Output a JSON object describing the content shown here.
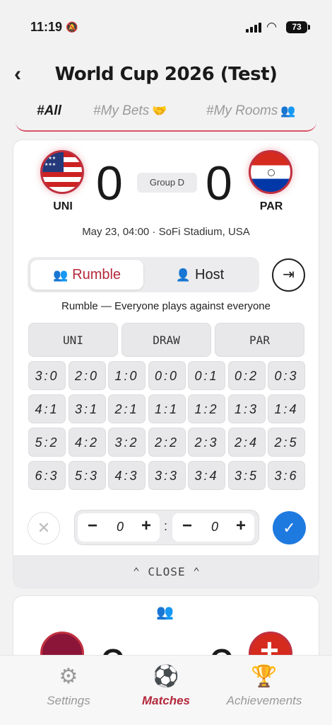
{
  "status": {
    "time": "11:19",
    "battery": "73"
  },
  "header": {
    "title": "World Cup 2026 (Test)"
  },
  "tabs": [
    {
      "label": "#All"
    },
    {
      "label": "#My Bets"
    },
    {
      "label": "#My Rooms"
    }
  ],
  "match": {
    "home": {
      "code": "UNI",
      "score": "0"
    },
    "away": {
      "code": "PAR",
      "score": "0"
    },
    "group": "Group D",
    "meta": "May 23, 04:00 · SoFi Stadium, USA"
  },
  "modes": {
    "rumble": "Rumble",
    "host": "Host",
    "description": "Rumble — Everyone plays against everyone"
  },
  "outcomes": [
    "UNI",
    "DRAW",
    "PAR"
  ],
  "scores": [
    [
      "3:0",
      "2:0",
      "1:0",
      "0:0",
      "0:1",
      "0:2",
      "0:3"
    ],
    [
      "4:1",
      "3:1",
      "2:1",
      "1:1",
      "1:2",
      "1:3",
      "1:4"
    ],
    [
      "5:2",
      "4:2",
      "3:2",
      "2:2",
      "2:3",
      "2:4",
      "2:5"
    ],
    [
      "6:3",
      "5:3",
      "4:3",
      "3:3",
      "3:4",
      "3:5",
      "3:6"
    ]
  ],
  "stepper": {
    "home": "0",
    "away": "0",
    "separator": ":"
  },
  "close_label": "⌃ CLOSE ⌃",
  "match2": {
    "home_score": "0",
    "away_score": "0"
  },
  "nav": {
    "settings": "Settings",
    "matches": "Matches",
    "achievements": "Achievements"
  }
}
